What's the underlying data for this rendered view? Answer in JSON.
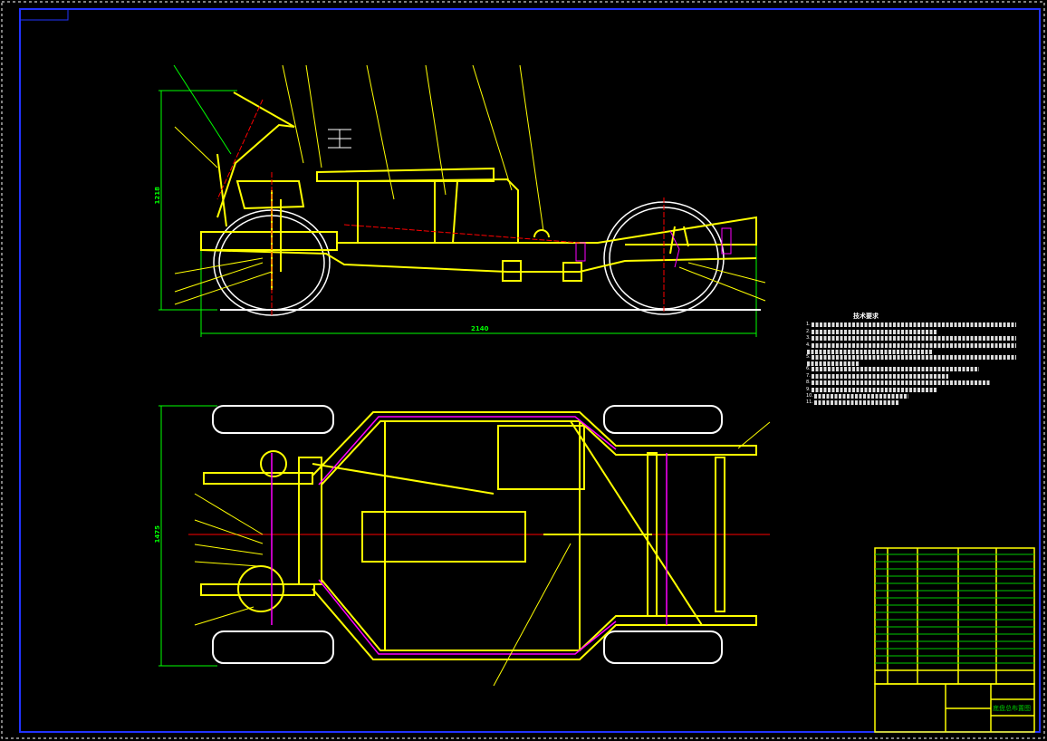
{
  "drawing": {
    "title_block_name": "底盘总布置图",
    "colors": {
      "background": "#000000",
      "frame": "#ffff00",
      "wheels": "#ffffff",
      "dimensions": "#00ff00",
      "centerlines": "#ff0000",
      "pipes": "#ff00ff",
      "border": "#0000ff"
    }
  },
  "dimensions": {
    "side_height": "1218",
    "side_length": "2140",
    "top_width": "1475"
  },
  "technical_requirements": {
    "heading": "技术要求",
    "items": [
      "1.",
      "2.",
      "3.",
      "4.",
      "",
      "5.",
      "",
      "6.",
      "7.",
      "8.",
      "9.",
      "10.",
      "11."
    ]
  }
}
